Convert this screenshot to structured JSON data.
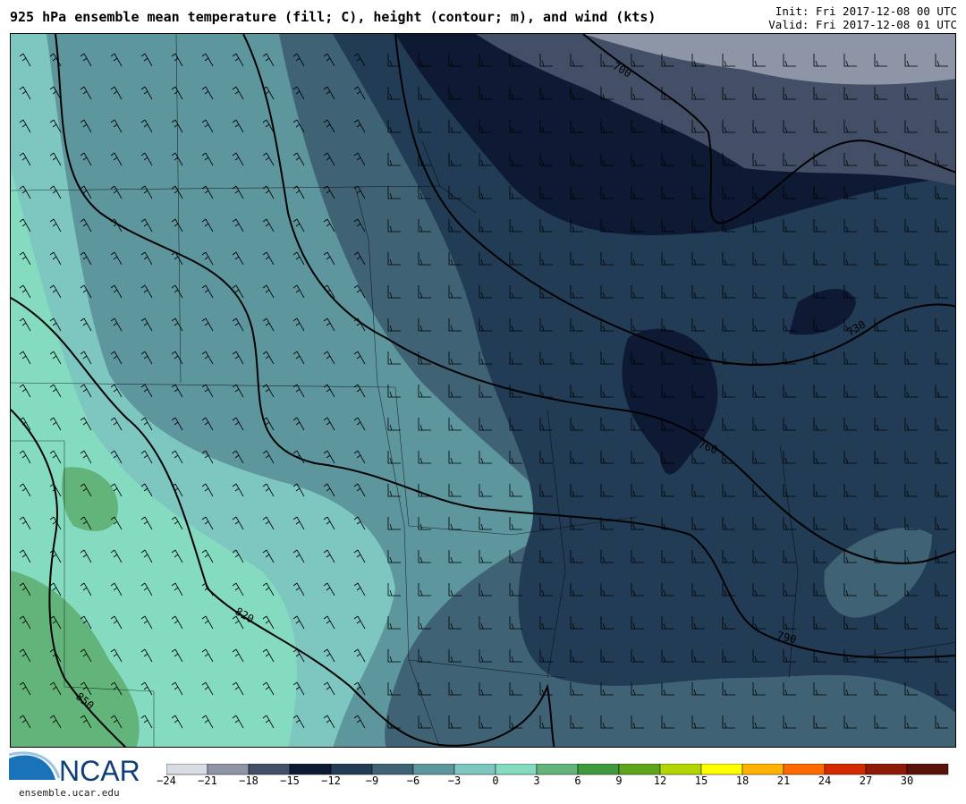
{
  "header": {
    "title": "925 hPa ensemble mean temperature (fill; C), height (contour; m), and wind (kts)",
    "init": "Init: Fri 2017-12-08 00 UTC",
    "valid": "Valid: Fri 2017-12-08 01 UTC"
  },
  "contour_labels": [
    "700",
    "730",
    "760",
    "790",
    "820",
    "850"
  ],
  "colorbar": {
    "ticks": [
      "−24",
      "−21",
      "−18",
      "−15",
      "−12",
      "−9",
      "−6",
      "−3",
      "0",
      "3",
      "6",
      "9",
      "12",
      "15",
      "18",
      "21",
      "24",
      "27",
      "30"
    ],
    "colors": [
      "#d8dce4",
      "#8d95a6",
      "#434f66",
      "#0e1a33",
      "#223c55",
      "#3f6375",
      "#5e969d",
      "#7ec6c0",
      "#85dbbf",
      "#62b47a",
      "#3d9a3d",
      "#5da61b",
      "#b2d600",
      "#ffff00",
      "#ffb300",
      "#ff6a00",
      "#d42a00",
      "#8e1a07",
      "#5a1308"
    ]
  },
  "footer": {
    "logo_text": "NCAR",
    "url": "ensemble.ucar.edu"
  }
}
